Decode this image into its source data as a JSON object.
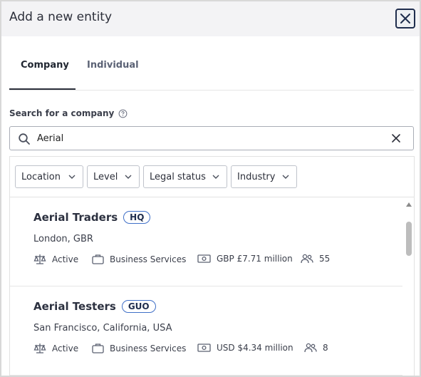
{
  "dialog": {
    "title": "Add a new entity"
  },
  "tabs": [
    {
      "label": "Company",
      "active": true
    },
    {
      "label": "Individual",
      "active": false
    }
  ],
  "search": {
    "label": "Search for a company",
    "value": "Aerial"
  },
  "filters": [
    {
      "label": "Location"
    },
    {
      "label": "Level"
    },
    {
      "label": "Legal status"
    },
    {
      "label": "Industry"
    }
  ],
  "results": [
    {
      "name": "Aerial Traders",
      "badge": "HQ",
      "location": "London, GBR",
      "status": "Active",
      "industry": "Business Services",
      "revenue": "GBP £7.71 million",
      "employees": "55"
    },
    {
      "name": "Aerial Testers",
      "badge": "GUO",
      "location": "San Francisco, California, USA",
      "status": "Active",
      "industry": "Business Services",
      "revenue": "USD $4.34 million",
      "employees": "8"
    }
  ],
  "icons": {
    "close": "close-icon",
    "help": "question-circle-icon",
    "search": "search-icon",
    "clear": "clear-icon",
    "chevron": "chevron-down-icon",
    "status": "scales-icon",
    "industry": "briefcase-icon",
    "revenue": "banknote-icon",
    "employees": "people-icon"
  },
  "colors": {
    "badge_border": "#3f6fc7",
    "header_bg": "#f3f3f5",
    "text_primary": "#2c3140"
  }
}
